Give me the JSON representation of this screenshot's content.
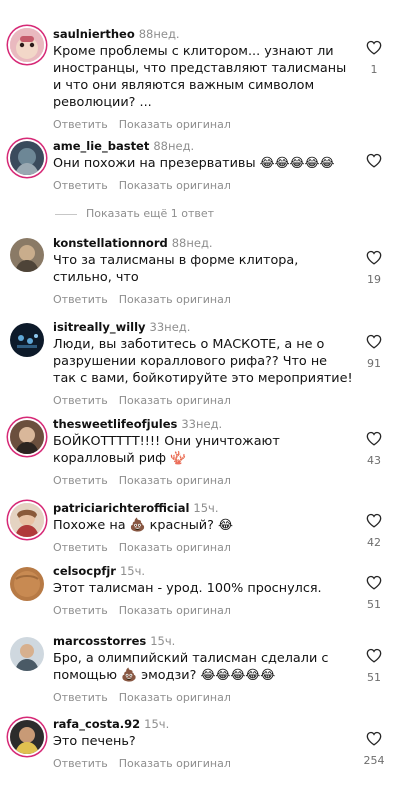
{
  "comments": [
    {
      "user": "saulniertheo",
      "time": "88нед.",
      "text": "Кроме проблемы с клитором... узнают ли иностранцы, что представляют талисманы и что они являются важным символом революции? ...",
      "likes": "1"
    },
    {
      "user": "ame_lie_bastet",
      "time": "88нед.",
      "text": "Они похожи на презервативы 😂😂😂😂😂",
      "likes": ""
    },
    {
      "user": "konstellationnord",
      "time": "88нед.",
      "text": "Что за талисманы в форме клитора, стильно, что",
      "likes": "19"
    },
    {
      "user": "isitreally_willy",
      "time": "33нед.",
      "text": "Люди, вы заботитесь о МАСКОТЕ, а не о разрушении кораллового рифа?? Что не так с вами, бойкотируйте это мероприятие!",
      "likes": "91"
    },
    {
      "user": "thesweetlifeofjules",
      "time": "33нед.",
      "text": "БОЙКОТТТТТ!!!! Они уничтожают коралловый риф 🪸",
      "likes": "43"
    },
    {
      "user": "patriciarichterofficial",
      "time": "15ч.",
      "text": "Похоже на 💩 красный? 😂",
      "likes": "42"
    },
    {
      "user": "celsocpfjr",
      "time": "15ч.",
      "text": "Этот талисман - урод. 100% проснулся.",
      "likes": "51"
    },
    {
      "user": "marcosstorres",
      "time": "15ч.",
      "text": "Бро, а олимпийский талисман сделали с помощью 💩 эмодзи? 😂😂😂😂😂",
      "likes": "51"
    },
    {
      "user": "rafa_costa.92",
      "time": "15ч.",
      "text": "Это печень?",
      "likes": "254"
    }
  ],
  "actions": {
    "reply": "Ответить",
    "translate": "Показать оригинал"
  },
  "show_more": "Показать ещё 1 ответ",
  "icons": {
    "like": "heart-outline-icon"
  },
  "colors": {
    "muted": "#8e8e8e",
    "story_ring": "#d62976"
  }
}
